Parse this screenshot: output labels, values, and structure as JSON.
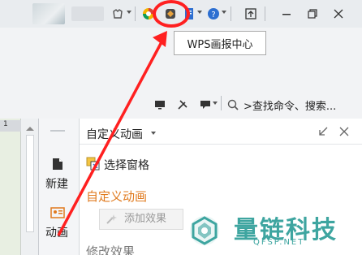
{
  "titlebar": {
    "tooltip": "WPS画报中心"
  },
  "toolbar2": {
    "search_text": ">查找命令、搜索..."
  },
  "ruler": {
    "marker": "1"
  },
  "sidetabs": {
    "new_label": "新建",
    "anim_label": "动画"
  },
  "pane": {
    "title": "自定义动画",
    "select_pane": "选择窗格",
    "section_custom": "自定义动画",
    "add_effect": "添加效果",
    "modify_effect": "修改效果"
  },
  "watermark": {
    "brand": "量链科技",
    "domain": "QFSP.NET"
  },
  "colors": {
    "accent_orange": "#e07a1e",
    "annotation_red": "#ff2020",
    "watermark_teal": "#3ea5a0"
  }
}
